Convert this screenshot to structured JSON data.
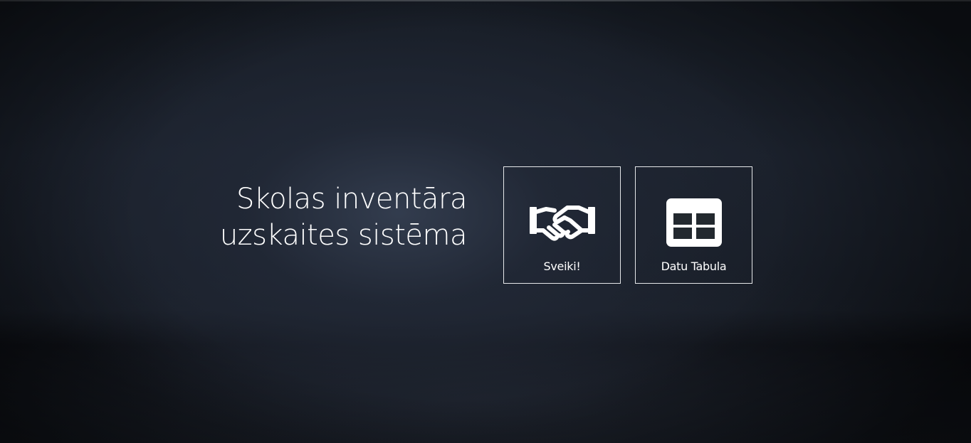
{
  "header": {
    "title_line1": "Skolas inventāra",
    "title_line2": "uzskaites sistēma"
  },
  "tiles": [
    {
      "label": "Sveiki!",
      "icon": "handshake-icon"
    },
    {
      "label": "Datu Tabula",
      "icon": "table-icon"
    }
  ],
  "colors": {
    "background": "#1b212c",
    "text": "#ffffff",
    "tile_border": "#e6e8ea"
  }
}
